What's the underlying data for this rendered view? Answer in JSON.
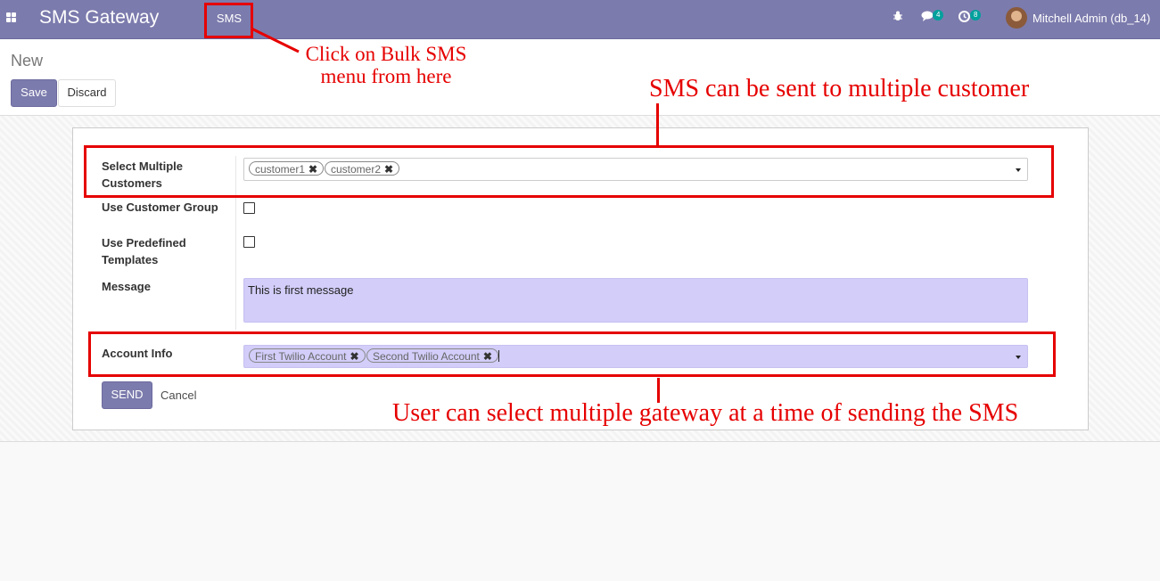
{
  "navbar": {
    "app_title": "SMS Gateway",
    "menu_sms": "SMS",
    "messages_badge": "4",
    "activities_badge": "8",
    "user": "Mitchell Admin (db_14)"
  },
  "control": {
    "breadcrumb": "New",
    "save_label": "Save",
    "discard_label": "Discard"
  },
  "form": {
    "customers_label_1": "Select Multiple",
    "customers_label_2": "Customers",
    "customers": [
      "customer1",
      "customer2"
    ],
    "customer_group_label": "Use Customer Group",
    "customer_group_checked": false,
    "templates_label_1": "Use Predefined",
    "templates_label_2": "Templates",
    "templates_checked": false,
    "message_label": "Message",
    "message_value": "This is first message",
    "account_label": "Account Info",
    "accounts": [
      "First Twilio Account",
      "Second Twilio Account"
    ],
    "send_label": "SEND",
    "cancel_label": "Cancel"
  },
  "annotations": {
    "menu_note_1": "Click on Bulk SMS",
    "menu_note_2": "menu from here",
    "customers_note": "SMS can be sent to multiple customer",
    "gateway_note": "User can select multiple gateway at a time of sending the SMS"
  },
  "colors": {
    "brand": "#7c7bad",
    "field_highlight": "#d2cdf9",
    "annotation": "#e60000",
    "badge": "#00a09d"
  }
}
